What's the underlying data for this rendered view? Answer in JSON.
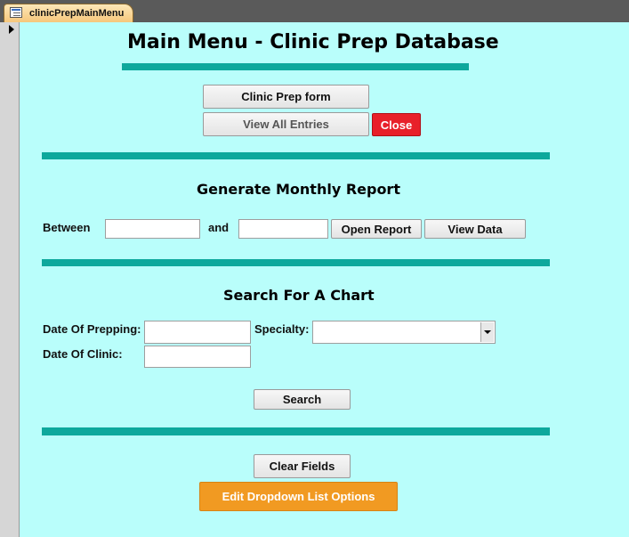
{
  "tab": {
    "label": "clinicPrepMainMenu"
  },
  "header": {
    "title": "Main Menu - Clinic Prep Database"
  },
  "top_buttons": {
    "clinic_prep_form": "Clinic Prep form",
    "view_all_entries": "View All Entries",
    "close": "Close"
  },
  "monthly_report": {
    "title": "Generate Monthly Report",
    "between_label": "Between",
    "and_label": "and",
    "start_date_value": "",
    "end_date_value": "",
    "open_report_button": "Open Report",
    "view_data_button": "View Data"
  },
  "search": {
    "title": "Search For A Chart",
    "date_of_prepping_label": "Date Of Prepping:",
    "date_of_clinic_label": "Date Of Clinic:",
    "specialty_label": "Specialty:",
    "date_of_prepping_value": "",
    "date_of_clinic_value": "",
    "specialty_value": "",
    "search_button": "Search"
  },
  "footer_buttons": {
    "clear_fields": "Clear Fields",
    "edit_dropdown": "Edit Dropdown List Options"
  },
  "colors": {
    "form_background": "#b9fefb",
    "rule": "#0da89c",
    "close_button": "#e8202a",
    "edit_button": "#f19a22"
  }
}
